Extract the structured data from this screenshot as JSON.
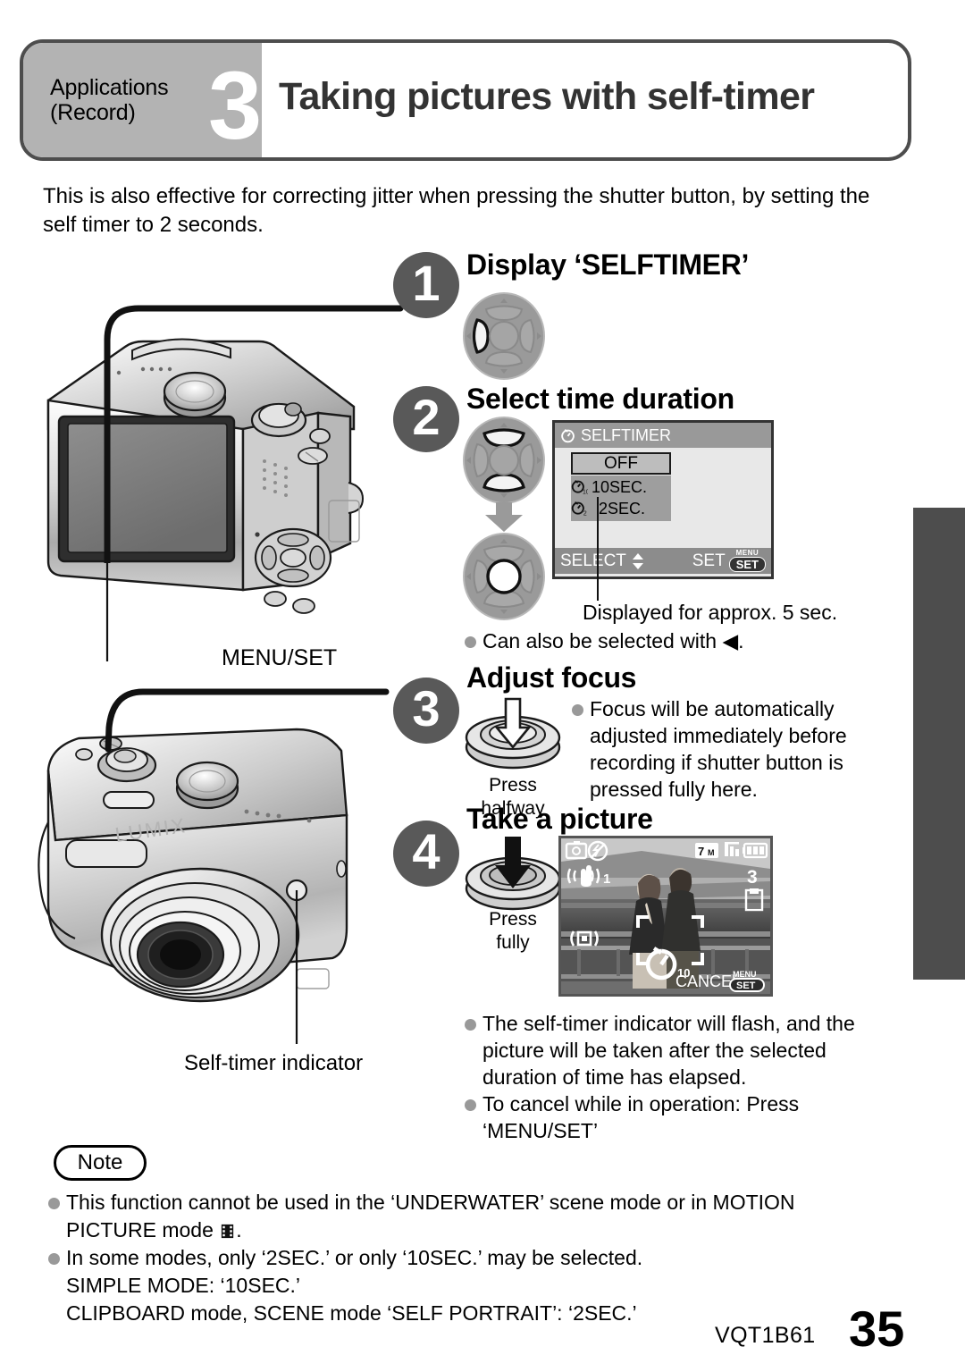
{
  "header": {
    "category_line1": "Applications",
    "category_line2": "(Record)",
    "number": "3",
    "title": "Taking pictures with self-timer",
    "gray_hex": "#b3b3b3",
    "border_hex": "#4d4d4d"
  },
  "intro": "This is also effective for correcting jitter when pressing the shutter button, by setting the self timer to 2 seconds.",
  "steps": [
    {
      "number": "1",
      "heading": "Display ‘SELFTIMER’",
      "icon": "cursor-pad-left-icon"
    },
    {
      "number": "2",
      "heading": "Select time duration",
      "icon": "cursor-pad-updown-icon"
    },
    {
      "number": "3",
      "heading": "Adjust focus",
      "icon": "shutter-halfway-icon"
    },
    {
      "number": "4",
      "heading": "Take a picture",
      "icon": "shutter-full-icon"
    }
  ],
  "selftimer_menu": {
    "title": "SELFTIMER",
    "title_icon": "selftimer-icon",
    "options": [
      {
        "label": "OFF",
        "icon": "",
        "selected": true
      },
      {
        "label": "10SEC.",
        "icon": "selftimer-10-icon",
        "selected": false
      },
      {
        "label": "2SEC.",
        "icon": "selftimer-2-icon",
        "selected": false
      }
    ],
    "footer_left": "SELECT",
    "footer_left_icon": "updown-arrow-icon",
    "footer_right": "SET",
    "footer_badge_top": "MENU",
    "footer_badge_bottom": "SET"
  },
  "step2_notes": {
    "caption": "Displayed for approx. 5 sec.",
    "bullet": "Can also be selected with ◀."
  },
  "step3": {
    "press_label_line1": "Press",
    "press_label_line2": "halfway",
    "bullet": "Focus will be automatically adjusted immediately before recording if shutter button is pressed fully here."
  },
  "step4": {
    "press_label_line1": "Press",
    "press_label_line2": "fully",
    "bullets": [
      "The self-timer indicator will flash, and the picture will be taken after the selected duration of time has elapsed.",
      "To cancel while in operation: Press ‘MENU/SET’"
    ]
  },
  "lcd_preview": {
    "icons": {
      "rec_mode": "camera-icon",
      "flash_off": "flash-off-icon",
      "picture_size": "7M",
      "quality": "quality-icon",
      "battery": "battery-icon",
      "stabilizer": "stabilizer-icon",
      "stabilizer_value": "1",
      "remaining_count": "3",
      "card": "card-icon",
      "metering": "metering-icon",
      "selftimer": "selftimer-icon",
      "selftimer_value": "10"
    },
    "cancel_label": "CANCEL",
    "cancel_badge_top": "MENU",
    "cancel_badge_bottom": "SET"
  },
  "callouts": {
    "menu_set": "MENU/SET",
    "self_timer_indicator": "Self-timer indicator",
    "brand": "LUMIX"
  },
  "note": {
    "pill_label": "Note",
    "items": [
      {
        "text_before": "This function cannot be used in the ‘UNDERWATER’ scene mode or in MOTION PICTURE mode ",
        "icon": "motion-picture-icon",
        "text_after": "."
      },
      {
        "text_before": "In some modes, only ‘2SEC.’ or only ‘10SEC.’ may be selected.",
        "icon": "",
        "text_after": ""
      }
    ],
    "sub_lines": [
      "SIMPLE MODE: ‘10SEC.’",
      "CLIPBOARD mode, SCENE mode ‘SELF PORTRAIT’: ‘2SEC.’"
    ]
  },
  "footer": {
    "code": "VQT1B61",
    "page": "35"
  }
}
